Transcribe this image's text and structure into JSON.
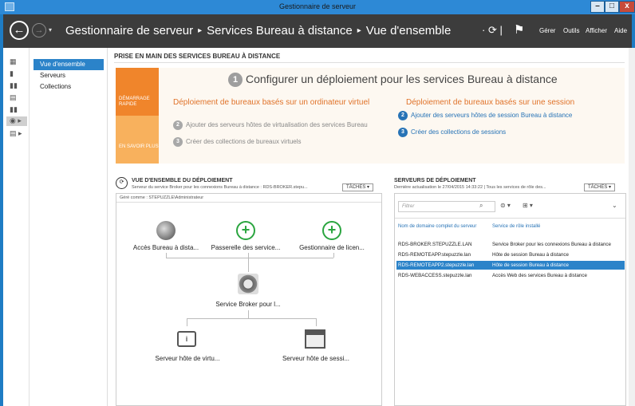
{
  "window": {
    "title": "Gestionnaire de serveur"
  },
  "header": {
    "breadcrumb": [
      "Gestionnaire de serveur",
      "Services Bureau à distance",
      "Vue d'ensemble"
    ],
    "menu": [
      "Gérer",
      "Outils",
      "Afficher",
      "Aide"
    ]
  },
  "sidebar": {
    "items": [
      {
        "label": "Vue d'ensemble",
        "active": true
      },
      {
        "label": "Serveurs"
      },
      {
        "label": "Collections"
      }
    ]
  },
  "quickstart": {
    "section_title": "PRISE EN MAIN DES SERVICES BUREAU À DISTANCE",
    "strip1": "DÉMARRAGE RAPIDE",
    "strip2": "EN SAVOIR PLUS",
    "title_num": "1",
    "title": "Configurer un déploiement pour les services Bureau à distance",
    "left_heading": "Déploiement de bureaux basés sur un ordinateur virtuel",
    "left_steps": [
      {
        "num": "2",
        "label": "Ajouter des serveurs hôtes de virtualisation des services Bureau"
      },
      {
        "num": "3",
        "label": "Créer des collections de bureaux virtuels"
      }
    ],
    "right_heading": "Déploiement de bureaux basés sur une session",
    "right_steps": [
      {
        "num": "2",
        "label": "Ajouter des serveurs hôtes de session Bureau à distance"
      },
      {
        "num": "3",
        "label": "Créer des collections de sessions"
      }
    ]
  },
  "overview": {
    "title": "VUE D'ENSEMBLE DU DÉPLOIEMENT",
    "subtitle": "Serveur du service Broker pour les connexions Bureau à distance : RDS-BROKER.stepu...",
    "tasks": "TÂCHES",
    "managed_by": "Géré comme : STEPUZZLE\\Administrateur",
    "roles": {
      "web_access": "Accès Bureau à dista...",
      "gateway": "Passerelle des service...",
      "licensing": "Gestionnaire de licen...",
      "broker": "Service Broker pour l...",
      "virt_host": "Serveur hôte de virtu...",
      "session_host": "Serveur hôte de sessi..."
    }
  },
  "servers": {
    "title": "SERVEURS DE DÉPLOIEMENT",
    "subtitle": "Dernière actualisation le 27/04/2015 14:33:22 | Tous les services de rôle des...",
    "tasks": "TÂCHES",
    "filter_placeholder": "Filtrer",
    "columns": [
      "Nom de domaine complet du serveur",
      "Service de rôle installé"
    ],
    "rows": [
      {
        "name": "RDS-BROKER.STEPUZZLE.LAN",
        "role": "Service Broker pour les connexions Bureau à distance"
      },
      {
        "name": "RDS-REMOTEAPP.stepuzzle.lan",
        "role": "Hôte de session Bureau à distance"
      },
      {
        "name": "RDS-REMOTEAPP2.stepuzzle.lan",
        "role": "Hôte de session Bureau à distance",
        "selected": true
      },
      {
        "name": "RDS-WEBACCESS.stepuzzle.lan",
        "role": "Accès Web des services Bureau à distance"
      }
    ]
  }
}
